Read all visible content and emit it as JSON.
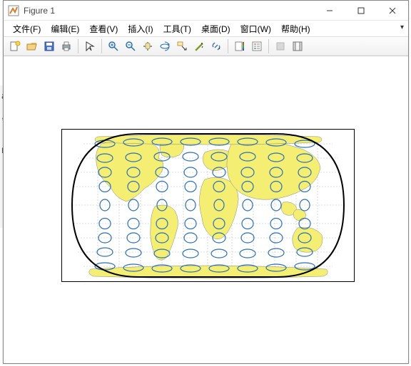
{
  "window": {
    "title": "Figure 1"
  },
  "menu": {
    "file": "文件(F)",
    "edit": "编辑(E)",
    "view": "查看(V)",
    "insert": "插入(I)",
    "tools": "工具(T)",
    "desktop": "桌面(D)",
    "window": "窗口(W)",
    "help": "帮助(H)"
  },
  "ghost": {
    "a": "a",
    "comma": ",",
    "r": "r"
  },
  "icons": {
    "new": "new-figure",
    "open": "open",
    "save": "save",
    "print": "print",
    "pointer": "pointer",
    "zoomin": "zoom-in",
    "zoomout": "zoom-out",
    "pan": "pan",
    "rotate": "rotate-3d",
    "datacursor": "data-cursor",
    "brush": "brush",
    "link": "link",
    "colorbar": "insert-colorbar",
    "legend": "insert-legend",
    "hideplot": "hide-plot-tools",
    "showplot": "show-plot-tools"
  }
}
